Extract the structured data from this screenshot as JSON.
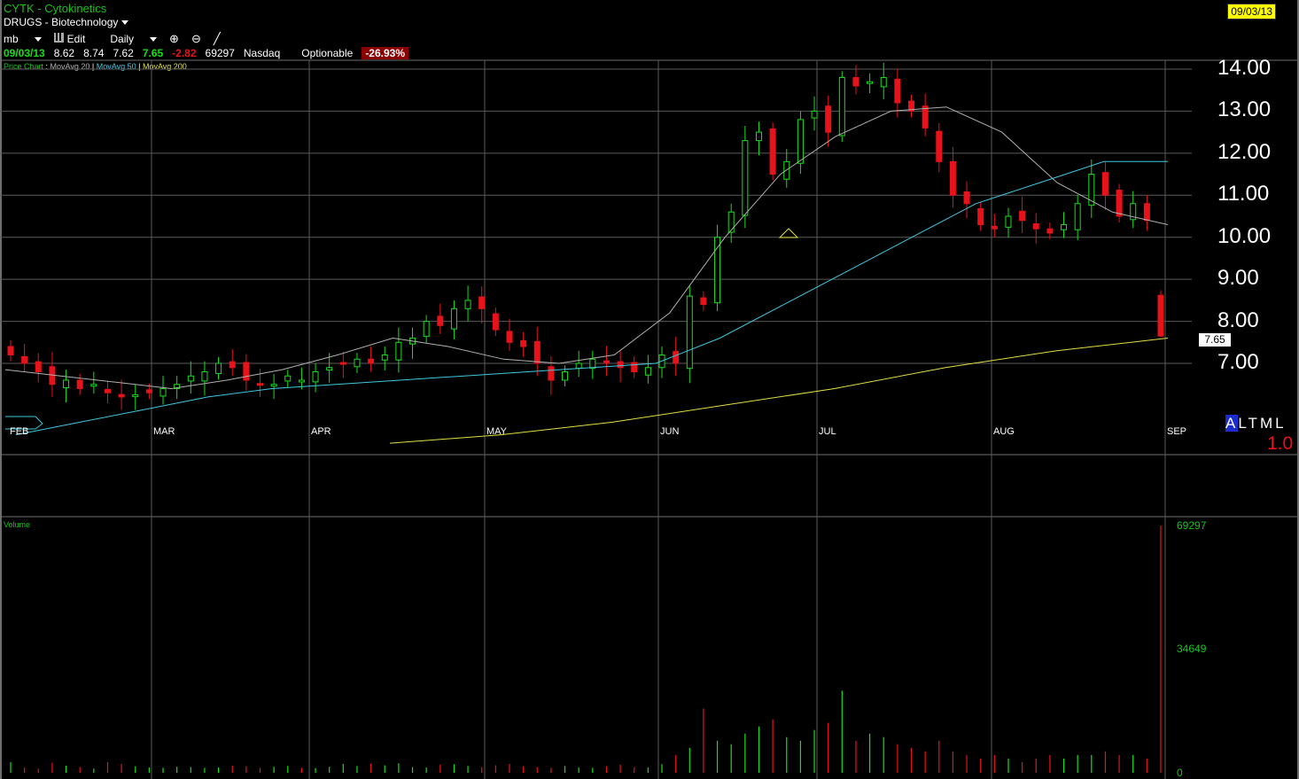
{
  "header": {
    "title": "CYTK - Cytokinetics",
    "group": "DRUGS - Biotechnology",
    "date_box": "09/03/13",
    "toolbar": {
      "user": "mb",
      "edit": "Edit",
      "period": "Daily"
    },
    "quote": {
      "date": "09/03/13",
      "open": "8.62",
      "high": "8.74",
      "low": "7.62",
      "close": "7.65",
      "change": "-2.82",
      "volume": "69297",
      "exchange": "Nasdaq",
      "optionable": "Optionable",
      "change_pct": "-26.93%"
    },
    "legend": {
      "price": "Price Chart",
      "ma20": "MovAvg 20",
      "ma50": "MovAvg 50",
      "ma200": "MovAvg 200"
    }
  },
  "right_panel": {
    "last_price": "7.65",
    "altml": [
      "A",
      "L",
      "T",
      "M",
      "L"
    ],
    "ratio": "1.0"
  },
  "colors": {
    "up": "#16e016",
    "down": "#e8121a",
    "ma20": "#b0b0b0",
    "ma50": "#3fc8e0",
    "ma200": "#e0e040",
    "grid": "#5a5a5a"
  },
  "chart_data": [
    {
      "type": "candlestick",
      "title": "CYTK - Cytokinetics",
      "y_ticks": [
        "14.00",
        "13.00",
        "12.00",
        "11.00",
        "10.00",
        "9.00",
        "8.00",
        "7.00"
      ],
      "ylim": [
        6.0,
        14.2
      ],
      "month_labels": [
        "FEB",
        "MAR",
        "APR",
        "MAY",
        "JUN",
        "JUL",
        "AUG",
        "SEP"
      ],
      "grid": true,
      "series": [
        {
          "name": "Price Chart",
          "close": [
            7.2,
            7.0,
            6.8,
            6.5,
            6.6,
            6.4,
            6.5,
            6.3,
            6.2,
            6.25,
            6.3,
            6.4,
            6.5,
            6.7,
            6.8,
            7.0,
            6.9,
            6.6,
            6.5,
            6.5,
            6.7,
            6.6,
            6.8,
            6.9,
            7.0,
            7.1,
            7.0,
            7.2,
            7.5,
            7.6,
            8.0,
            7.9,
            8.3,
            8.5,
            8.3,
            7.8,
            7.5,
            7.4,
            7.0,
            6.6,
            6.8,
            7.0,
            7.1,
            7.0,
            6.9,
            6.8,
            6.9,
            7.2,
            7.0,
            8.6,
            8.4,
            10.0,
            10.6,
            12.3,
            12.5,
            11.5,
            11.8,
            12.8,
            13.0,
            12.5,
            13.8,
            13.6,
            13.7,
            13.8,
            13.2,
            13.0,
            12.6,
            11.8,
            11.0,
            10.8,
            10.3,
            10.2,
            10.5,
            10.4,
            10.2,
            10.1,
            10.3,
            10.8,
            11.5,
            11.0,
            10.5,
            10.8,
            10.4,
            7.65
          ]
        },
        {
          "name": "MovAvg 20",
          "values": [
            6.85,
            6.7,
            6.55,
            6.4,
            6.6,
            6.85,
            7.2,
            7.6,
            7.4,
            7.1,
            7.0,
            7.2,
            8.2,
            10.0,
            11.5,
            12.4,
            13.0,
            13.1,
            12.5,
            11.3,
            10.6,
            10.3
          ]
        },
        {
          "name": "MovAvg 50",
          "values": [
            5.3,
            5.6,
            5.9,
            6.2,
            6.4,
            6.5,
            6.6,
            6.7,
            6.8,
            6.9,
            7.0,
            7.6,
            8.4,
            9.2,
            10.0,
            10.8,
            11.3,
            11.8,
            11.8
          ]
        },
        {
          "name": "MovAvg 200",
          "values": [
            5.1,
            5.3,
            5.6,
            6.0,
            6.4,
            6.9,
            7.3,
            7.6
          ]
        }
      ]
    },
    {
      "type": "bar",
      "title": "Volume",
      "y_ticks": [
        "69297",
        "34649",
        "0"
      ],
      "ylim": [
        0,
        69297
      ],
      "values": [
        3000,
        1500,
        1200,
        2800,
        2000,
        1600,
        1200,
        3000,
        2500,
        1800,
        1500,
        1400,
        1700,
        1600,
        1400,
        1500,
        2000,
        1800,
        1400,
        1700,
        1900,
        1400,
        1300,
        1700,
        2500,
        1900,
        2600,
        2100,
        2700,
        1600,
        1500,
        2300,
        2400,
        1900,
        1600,
        2100,
        2500,
        1800,
        1600,
        1400,
        1900,
        1500,
        1400,
        1800,
        2300,
        1600,
        1500,
        2400,
        5000,
        7000,
        18000,
        9000,
        8000,
        11000,
        13000,
        15000,
        10000,
        9000,
        12000,
        14000,
        23000,
        9000,
        11000,
        10000,
        8000,
        7000,
        6000,
        9000,
        6000,
        5000,
        4000,
        5000,
        4000,
        3000,
        4000,
        5000,
        4000,
        5000,
        5000,
        6000,
        5000,
        5000,
        4000,
        69297
      ]
    }
  ]
}
